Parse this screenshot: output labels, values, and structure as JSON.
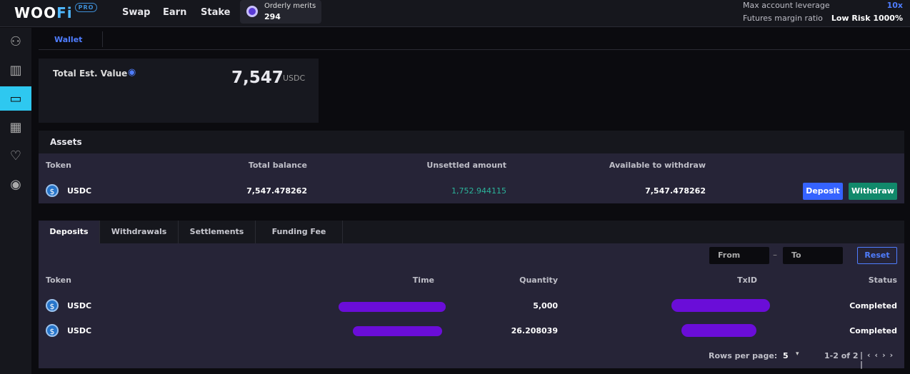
{
  "header": {
    "logo": "WOOFi",
    "logo_badge": "PRO",
    "nav": [
      "Swap",
      "Earn",
      "Stake"
    ],
    "merits_label": "Orderly merits",
    "merits_value": "294",
    "leverage_label": "Max account leverage",
    "leverage_value": "10x",
    "margin_label": "Futures margin ratio",
    "margin_value": "Low Risk 1000%"
  },
  "sidebar": {
    "items": [
      "account-icon",
      "chart-icon",
      "wallet-icon",
      "calculator-icon",
      "rewards-icon",
      "vault-icon"
    ],
    "active": 2
  },
  "tabs": {
    "wallet": "Wallet"
  },
  "summary": {
    "label": "Total Est. Value",
    "value": "7,547",
    "unit": "USDC"
  },
  "assets": {
    "title": "Assets",
    "headers": [
      "Token",
      "Total balance",
      "Unsettled amount",
      "Available to withdraw"
    ],
    "row": {
      "token": "USDC",
      "total": "7,547.478262",
      "unsettled": "1,752.944115",
      "available": "7,547.478262"
    },
    "deposit": "Deposit",
    "withdraw": "Withdraw"
  },
  "history": {
    "tabs": [
      "Deposits",
      "Withdrawals",
      "Settlements",
      "Funding Fee"
    ],
    "from": "From",
    "to": "To",
    "reset": "Reset",
    "headers": [
      "Token",
      "Time",
      "Quantity",
      "TxID",
      "Status"
    ],
    "rows": [
      {
        "token": "USDC",
        "quantity": "5,000",
        "status": "Completed"
      },
      {
        "token": "USDC",
        "quantity": "26.208039",
        "status": "Completed"
      }
    ],
    "rows_per_page_label": "Rows per page:",
    "rows_per_page": "5",
    "range": "1-2 of 2"
  },
  "colors": {
    "accent": "#2ec8f0",
    "deposit": "#3563ff",
    "withdraw": "#11896b",
    "unsettled": "#2bb39a"
  }
}
